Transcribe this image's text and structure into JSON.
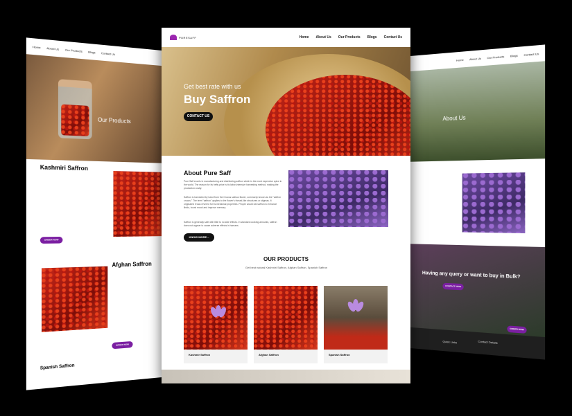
{
  "left_page": {
    "nav": [
      "Home",
      "About Us",
      "Our Products",
      "Blogs",
      "Contact Us"
    ],
    "hero_title": "Our Products",
    "section1_title": "Kashmiri Saffron",
    "section1_button": "ORDER NOW",
    "section2_title": "Afghan Saffron",
    "section2_button": "ORDER NOW",
    "section3_title": "Spanish Saffron"
  },
  "center_page": {
    "logo_text": "PURESAFF",
    "nav": {
      "home": "Home",
      "about": "About Us",
      "products": "Our Products",
      "blogs": "Blogs",
      "contact": "Contact Us"
    },
    "hero": {
      "subtitle": "Get best rate with us",
      "title": "Buy Saffron",
      "button": "CONTACT US"
    },
    "about": {
      "title": "About Pure Saff",
      "paragraphs": [
        "Pure Saff excels in manufacturing and distributing saffron which is the most expensive spice in the world. The reason for its hefty price is its labor-intensive harvesting method, making the production costly.",
        "Saffron is harvested by hand from the Crocus sativus flower, commonly known as the \"saffron crocus.\" The term \"saffron\" applies to the flower's thread-like structures or stigmas. It originated it was revered for its medicinal properties. People would eat saffron to enhance libido, boost mood and improve memory.",
        "Saffron is generally safe with little to no side effects. In standard cooking amounts, saffron does not appear to cause adverse effects in humans."
      ],
      "button": "KNOW MORE..."
    },
    "products": {
      "title": "OUR PRODUCTS",
      "subtitle": "Get best natural Kashmiri Saffron, Afghan Saffron, Spanish Saffron",
      "items": [
        "Kashmir Saffron",
        "Afghan Saffron",
        "Spanish Saffron"
      ]
    }
  },
  "right_page": {
    "nav": [
      "Home",
      "About Us",
      "Our Products",
      "Blogs",
      "Contact Us"
    ],
    "hero_title": "About Us",
    "band_text": "Having any query or want to buy in Bulk?",
    "band_button": "CONTACT NOW",
    "order_button": "ORDER NOW",
    "footer_links": [
      "Quick Links",
      "Contact Details"
    ]
  },
  "colors": {
    "accent_purple": "#7b1fa2",
    "button_dark": "#111111",
    "saffron_red": "#c7281a"
  }
}
